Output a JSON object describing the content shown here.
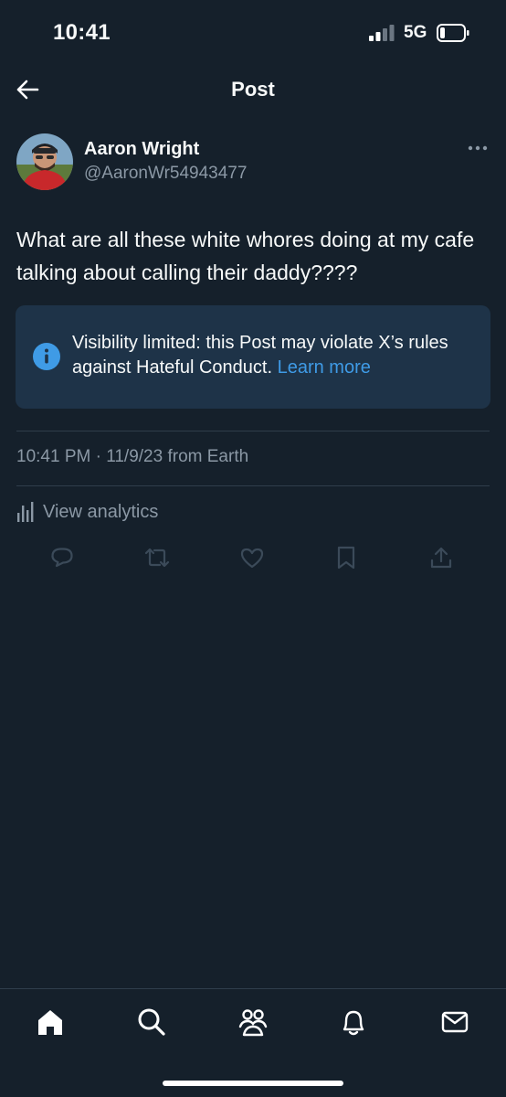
{
  "status_bar": {
    "time": "10:41",
    "network": "5G"
  },
  "header": {
    "title": "Post",
    "back_icon": "arrow-left-icon"
  },
  "post": {
    "author_name": "Aaron Wright",
    "author_handle": "@AaronWr54943477",
    "text": "What are all these white whores doing at my cafe talking about calling their daddy????",
    "notice": {
      "text": "Visibility limited: this Post may violate X’s rules against Hateful Conduct.",
      "link": "Learn more"
    },
    "meta": "10:41 PM · 11/9/23 from Earth",
    "analytics_label": "View analytics",
    "actions": [
      "reply-icon",
      "repost-icon",
      "like-icon",
      "bookmark-icon",
      "share-icon"
    ]
  },
  "tab_bar": {
    "tabs": [
      "home-icon",
      "search-icon",
      "communities-icon",
      "notifications-icon",
      "messages-icon"
    ]
  },
  "colors": {
    "background": "#15202b",
    "notice_background": "#1e3348",
    "accent": "#3f9be6",
    "muted_text": "#8b98a5"
  }
}
